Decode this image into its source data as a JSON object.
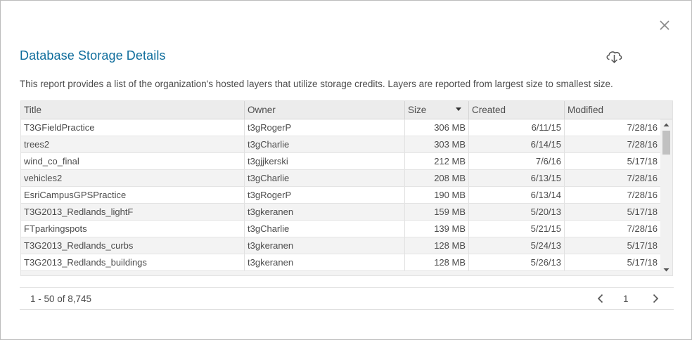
{
  "dialog": {
    "title": "Database Storage Details",
    "description": "This report provides a list of the organization's hosted layers that utilize storage credits. Layers are reported from largest size to smallest size."
  },
  "icons": {
    "close": "close-icon",
    "download": "cloud-download-icon",
    "sort": "sort-descending-icon",
    "prev": "chevron-left-icon",
    "next": "chevron-right-icon"
  },
  "colors": {
    "title": "#0f6d9c",
    "header_bg": "#ececec",
    "alt_row_bg": "#f3f3f3",
    "text": "#4c4c4c"
  },
  "table": {
    "columns": [
      "Title",
      "Owner",
      "Size",
      "Created",
      "Modified"
    ],
    "sorted_column": "Size",
    "sort_direction": "descending",
    "rows": [
      {
        "title": "T3GFieldPractice",
        "owner": "t3gRogerP",
        "size": "306 MB",
        "created": "6/11/15",
        "modified": "7/28/16"
      },
      {
        "title": "trees2",
        "owner": "t3gCharlie",
        "size": "303 MB",
        "created": "6/14/15",
        "modified": "7/28/16"
      },
      {
        "title": "wind_co_final",
        "owner": "t3gjjkerski",
        "size": "212 MB",
        "created": "7/6/16",
        "modified": "5/17/18"
      },
      {
        "title": "vehicles2",
        "owner": "t3gCharlie",
        "size": "208 MB",
        "created": "6/13/15",
        "modified": "7/28/16"
      },
      {
        "title": "EsriCampusGPSPractice",
        "owner": "t3gRogerP",
        "size": "190 MB",
        "created": "6/13/14",
        "modified": "7/28/16"
      },
      {
        "title": "T3G2013_Redlands_lightF",
        "owner": "t3gkeranen",
        "size": "159 MB",
        "created": "5/20/13",
        "modified": "5/17/18"
      },
      {
        "title": "FTparkingspots",
        "owner": "t3gCharlie",
        "size": "139 MB",
        "created": "5/21/15",
        "modified": "7/28/16"
      },
      {
        "title": "T3G2013_Redlands_curbs",
        "owner": "t3gkeranen",
        "size": "128 MB",
        "created": "5/24/13",
        "modified": "5/17/18"
      },
      {
        "title": "T3G2013_Redlands_buildings",
        "owner": "t3gkeranen",
        "size": "128 MB",
        "created": "5/26/13",
        "modified": "5/17/18"
      }
    ]
  },
  "pagination": {
    "range_text": "1 - 50 of 8,745",
    "current_page": "1"
  }
}
